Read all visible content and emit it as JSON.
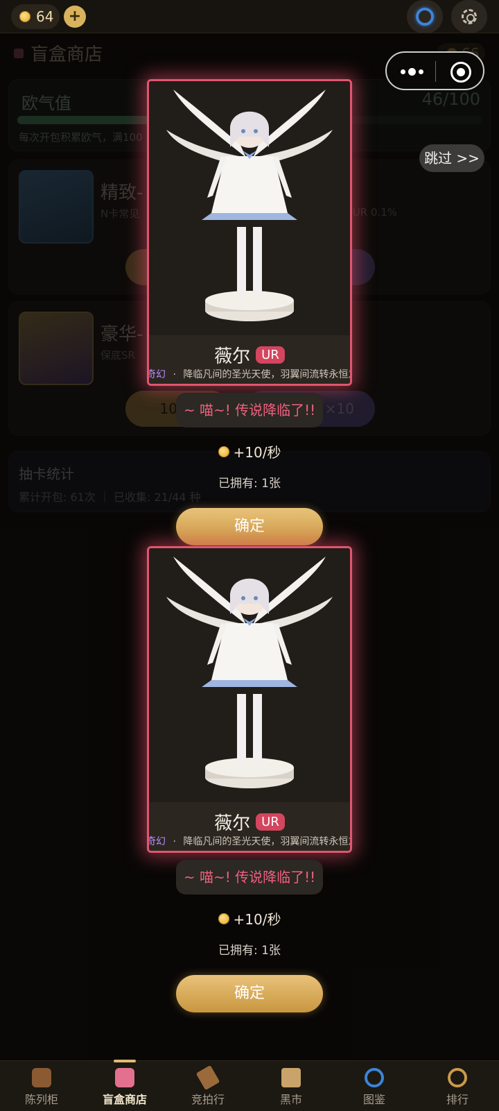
{
  "topbar": {
    "coins": "64",
    "add_label": "+"
  },
  "shop": {
    "title": "盲盒商店",
    "coin_display": "66",
    "luck": {
      "label": "欧气值",
      "count": "46/100",
      "progress": 0.46,
      "hint": "每次开包积累欧气，满100"
    },
    "packs": [
      {
        "name": "精致-",
        "desc": "N卡常见",
        "rate": "UR 0.1%"
      },
      {
        "name": "豪华-",
        "desc": "保底SR",
        "btn_a": "1000",
        "btn_b": "×10"
      }
    ],
    "stats": {
      "title": "抽卡统计",
      "summary": "累计开包: 61次 ｜ 已收集: 21/44 种"
    }
  },
  "capsule": {
    "more_icon": "more-dots-icon",
    "close_icon": "target-icon"
  },
  "skip_label": "跳过 >>",
  "reveals": [
    {
      "name": "薇尔",
      "rarity": "UR",
      "tag": "奇幻",
      "separator": "·",
      "flavor": "降临凡间的圣光天使，羽翼间流转永恒之",
      "speech": "~ 喵~! 传说降临了!!",
      "rate": "+10/秒",
      "owned": "已拥有: 1张",
      "confirm": "确定"
    },
    {
      "name": "薇尔",
      "rarity": "UR",
      "tag": "奇幻",
      "separator": "·",
      "flavor": "降临凡间的圣光天使，羽翼间流转永恒之",
      "speech": "~ 喵~! 传说降临了!!",
      "rate": "+10/秒",
      "owned": "已拥有: 1张",
      "confirm": "确定"
    }
  ],
  "tabs": [
    {
      "label": "陈列柜",
      "icon": "cabinet-icon"
    },
    {
      "label": "盲盒商店",
      "icon": "gift-box-icon",
      "active": true
    },
    {
      "label": "竞拍行",
      "icon": "hammer-icon"
    },
    {
      "label": "黑市",
      "icon": "scroll-icon"
    },
    {
      "label": "图鉴",
      "icon": "portal-icon"
    },
    {
      "label": "排行",
      "icon": "magnifier-icon"
    }
  ],
  "colors": {
    "accent_gold": "#e2b55a",
    "ur_red": "#d4455e",
    "card_glow": "#e0566f",
    "fantasy_tag": "#b98cff"
  }
}
